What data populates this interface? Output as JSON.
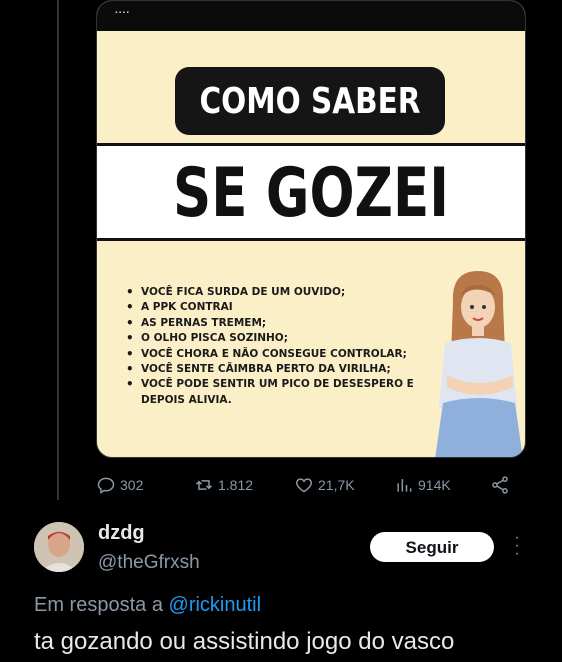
{
  "post": {
    "image": {
      "top_dots": "....",
      "title_line1": "COMO SABER",
      "title_line2": "SE GOZEI",
      "bullets": [
        "VOCÊ FICA SURDA DE UM OUVIDO;",
        "A PPK CONTRAI",
        "AS PERNAS TREMEM;",
        "O OLHO PISCA SOZINHO;",
        "VOCÊ CHORA E NÃO CONSEGUE CONTROLAR;",
        "VOCÊ SENTE CÃIMBRA PERTO DA VIRILHA;",
        "VOCÊ PODE SENTIR UM PICO DE DESESPERO E DEPOIS ALIVIA."
      ],
      "background_color": "#fbefc8"
    },
    "actions": {
      "replies": "302",
      "reposts": "1.812",
      "likes": "21,7K",
      "views": "914K"
    }
  },
  "reply": {
    "display_name": "dzdg",
    "handle": "@theGfrxsh",
    "follow_label": "Seguir",
    "in_reply_prefix": "Em resposta a ",
    "in_reply_mention": "@rickinutil",
    "text": "ta gozando ou assistindo jogo do vasco"
  },
  "colors": {
    "background": "#000000",
    "secondary_text": "#8b98a5",
    "link": "#1d9bf0",
    "primary_text": "#e7e9ea"
  }
}
